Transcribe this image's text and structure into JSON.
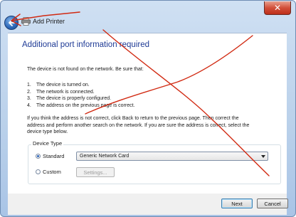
{
  "window": {
    "title": "Add Printer",
    "close_glyph": "✕"
  },
  "page": {
    "heading": "Additional port information required",
    "intro": "The device is not found on the network.  Be sure that:",
    "checklist": [
      {
        "num": "1.",
        "text": "The device is turned on."
      },
      {
        "num": "2.",
        "text": "The network is connected."
      },
      {
        "num": "3.",
        "text": "The device is properly configured."
      },
      {
        "num": "4.",
        "text": "The address on the previous page is correct."
      }
    ],
    "instructions_line1": "If you think the address is not correct, click Back to return to the previous page.  Then correct the",
    "instructions_line2": "address and perform another search on the network.  If you are sure the address is correct, select the",
    "instructions_line3": "device type below."
  },
  "device_type": {
    "group_label": "Device Type",
    "standard_label": "Standard",
    "standard_checked": true,
    "standard_value": "Generic Network Card",
    "custom_label": "Custom",
    "custom_checked": false,
    "settings_label": "Settings..."
  },
  "footer": {
    "next_label": "Next",
    "cancel_label": "Cancel"
  },
  "icons": {
    "back": "back-arrow-icon",
    "printer": "printer-icon",
    "dropdown": "chevron-down-icon"
  },
  "colors": {
    "heading": "#1e3a95",
    "annotation": "#d12a12",
    "back_button": "#2a66b8"
  }
}
